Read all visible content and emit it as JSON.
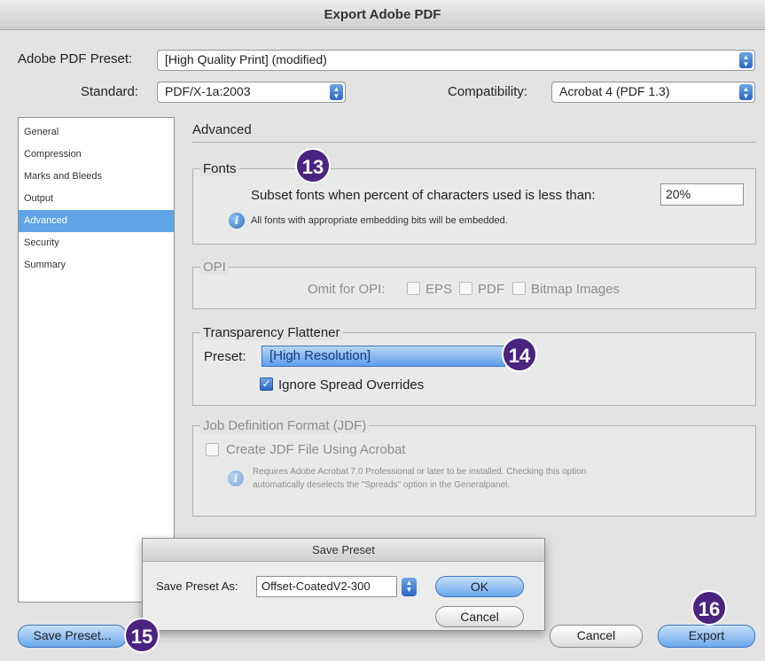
{
  "window": {
    "title": "Export Adobe PDF"
  },
  "top": {
    "preset_label": "Adobe PDF Preset:",
    "preset_value": "[High Quality Print] (modified)",
    "standard_label": "Standard:",
    "standard_value": "PDF/X-1a:2003",
    "compat_label": "Compatibility:",
    "compat_value": "Acrobat 4 (PDF 1.3)"
  },
  "sidebar": {
    "items": [
      "General",
      "Compression",
      "Marks and Bleeds",
      "Output",
      "Advanced",
      "Security",
      "Summary"
    ],
    "selected": "Advanced"
  },
  "panel": {
    "title": "Advanced"
  },
  "fonts": {
    "title": "Fonts",
    "subset_label": "Subset fonts when percent of characters used is less than:",
    "subset_value": "20%",
    "info": "All fonts with appropriate embedding bits will be embedded."
  },
  "opi": {
    "title": "OPI",
    "omit_label": "Omit for OPI:",
    "eps": "EPS",
    "pdf": "PDF",
    "bitmap": "Bitmap Images"
  },
  "transparency": {
    "title": "Transparency Flattener",
    "preset_label": "Preset:",
    "preset_value": "[High Resolution]",
    "ignore_label": "Ignore Spread Overrides",
    "ignore_checked": true
  },
  "jdf": {
    "title": "Job Definition Format (JDF)",
    "create_label": "Create JDF File Using Acrobat",
    "info_line1": "Requires Adobe Acrobat 7.0 Professional or later to be installed. Checking this option",
    "info_line2": "automatically deselects the \"Spreads\" option in the Generalpanel."
  },
  "save_preset_dialog": {
    "title": "Save Preset",
    "label": "Save Preset As:",
    "value": "Offset-CoatedV2-300",
    "ok": "OK",
    "cancel": "Cancel"
  },
  "buttons": {
    "save_preset": "Save Preset...",
    "cancel": "Cancel",
    "export": "Export"
  },
  "badges": [
    "13",
    "14",
    "15",
    "16"
  ],
  "colors": {
    "badge": "#4b2380",
    "selection": "#5fa5e8"
  }
}
